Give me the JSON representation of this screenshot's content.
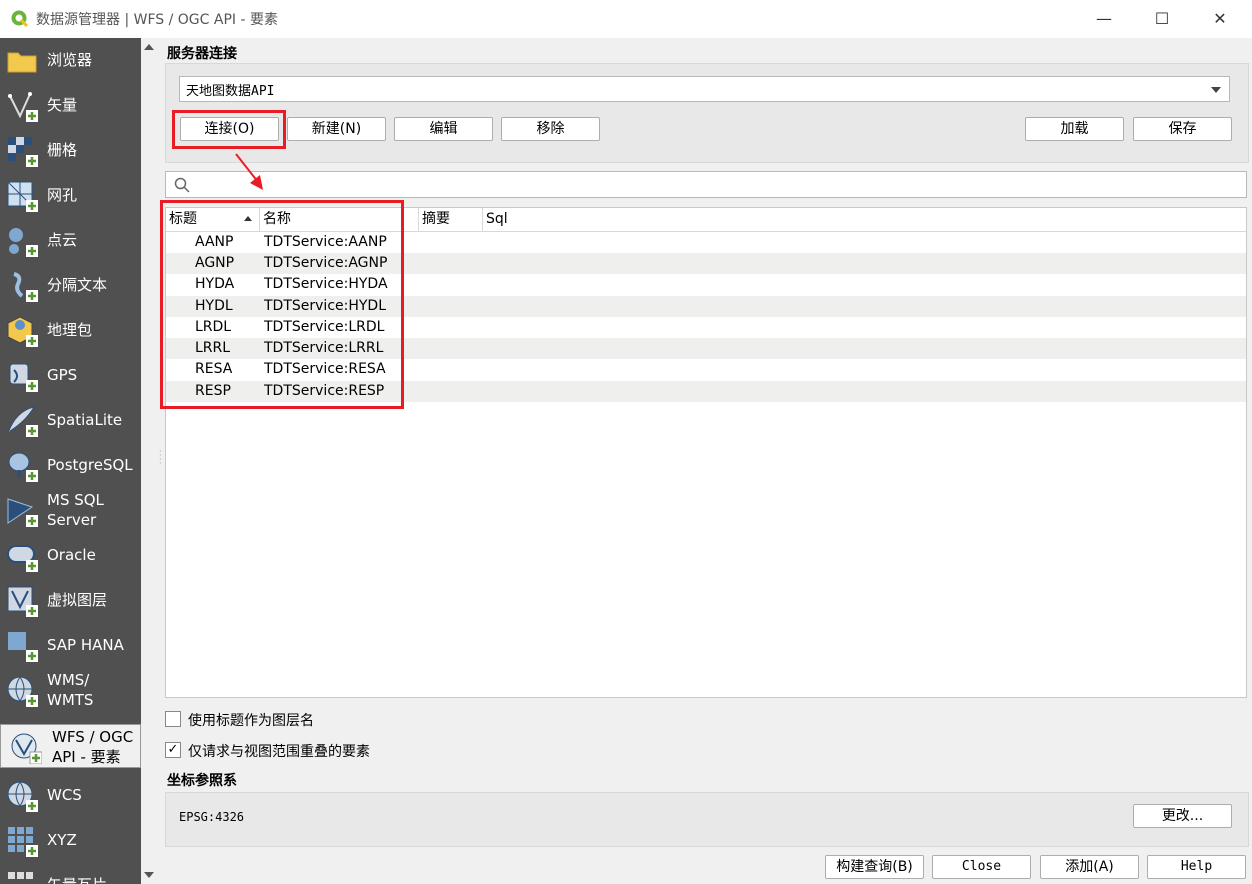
{
  "window": {
    "title": "数据源管理器 | WFS / OGC API - 要素",
    "minimize": "—",
    "maximize": "☐",
    "close": "✕"
  },
  "sidebar": {
    "items": [
      {
        "label": "浏览器",
        "icon": "folder-icon"
      },
      {
        "label": "矢量",
        "icon": "vector-icon"
      },
      {
        "label": "栅格",
        "icon": "raster-icon"
      },
      {
        "label": "网孔",
        "icon": "mesh-icon"
      },
      {
        "label": "点云",
        "icon": "point-cloud-icon"
      },
      {
        "label": "分隔文本",
        "icon": "delimited-text-icon"
      },
      {
        "label": "地理包",
        "icon": "geopackage-icon"
      },
      {
        "label": "GPS",
        "icon": "gps-icon"
      },
      {
        "label": "SpatiaLite",
        "icon": "spatialite-icon"
      },
      {
        "label": "PostgreSQL",
        "icon": "postgresql-icon"
      },
      {
        "label": "MS SQL Server",
        "icon": "mssql-icon"
      },
      {
        "label": "Oracle",
        "icon": "oracle-icon"
      },
      {
        "label": "虚拟图层",
        "icon": "virtual-layer-icon"
      },
      {
        "label": "SAP HANA",
        "icon": "sap-hana-icon"
      },
      {
        "label": "WMS/ WMTS",
        "icon": "wms-icon"
      },
      {
        "label": "WFS / OGC API - 要素",
        "icon": "wfs-icon",
        "active": true
      },
      {
        "label": "WCS",
        "icon": "wcs-icon"
      },
      {
        "label": "XYZ",
        "icon": "xyz-icon"
      },
      {
        "label": "矢量瓦片",
        "icon": "vector-tile-icon"
      }
    ]
  },
  "server": {
    "section_title": "服务器连接",
    "selected_connection": "天地图数据API",
    "buttons": {
      "connect": "连接(O)",
      "new": "新建(N)",
      "edit": "编辑",
      "remove": "移除",
      "load": "加载",
      "save": "保存"
    }
  },
  "search": {
    "placeholder": ""
  },
  "table": {
    "headers": [
      "标题",
      "名称",
      "摘要",
      "Sql"
    ],
    "rows": [
      {
        "title": "AANP",
        "name": "TDTService:AANP"
      },
      {
        "title": "AGNP",
        "name": "TDTService:AGNP"
      },
      {
        "title": "HYDA",
        "name": "TDTService:HYDA"
      },
      {
        "title": "HYDL",
        "name": "TDTService:HYDL"
      },
      {
        "title": "LRDL",
        "name": "TDTService:LRDL"
      },
      {
        "title": "LRRL",
        "name": "TDTService:LRRL"
      },
      {
        "title": "RESA",
        "name": "TDTService:RESA"
      },
      {
        "title": "RESP",
        "name": "TDTService:RESP"
      }
    ]
  },
  "options": {
    "use_title": {
      "label": "使用标题作为图层名",
      "checked": false
    },
    "only_overlap": {
      "label": "仅请求与视图范围重叠的要素",
      "checked": true,
      "mark": "✓"
    }
  },
  "crs": {
    "section_title": "坐标参照系",
    "value": "EPSG:4326",
    "change_button": "更改..."
  },
  "footer": {
    "build_query": "构建查询(B)",
    "close": "Close",
    "add": "添加(A)",
    "help": "Help"
  },
  "colors": {
    "sidebar_bg": "#505050",
    "highlight": "#e81c24",
    "row_alt": "#efefee"
  }
}
